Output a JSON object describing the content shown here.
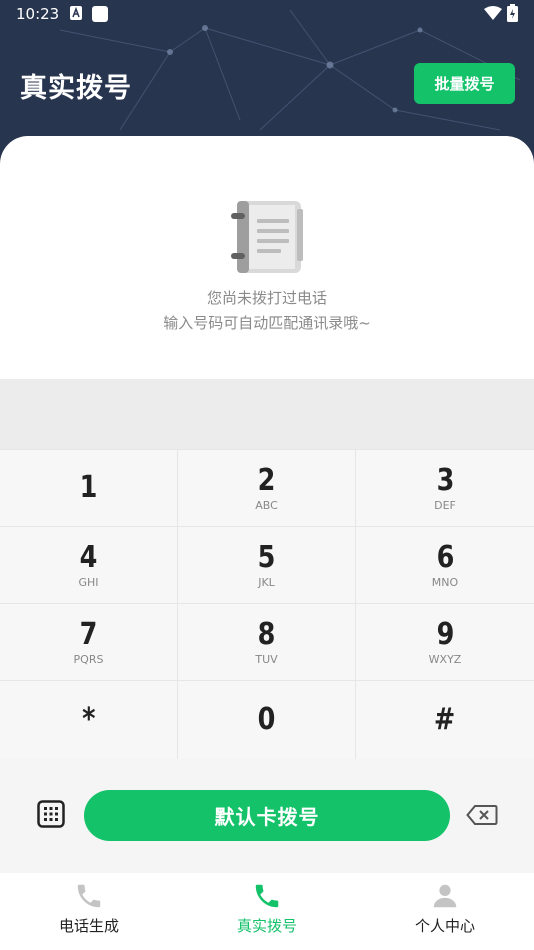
{
  "status_bar": {
    "time": "10:23"
  },
  "header": {
    "title": "真实拨号",
    "bulk_button": "批量拨号"
  },
  "empty_state": {
    "line1": "您尚未拨打过电话",
    "line2": "输入号码可自动匹配通讯录哦~"
  },
  "keypad": {
    "keys": [
      {
        "digit": "1",
        "letters": ""
      },
      {
        "digit": "2",
        "letters": "ABC"
      },
      {
        "digit": "3",
        "letters": "DEF"
      },
      {
        "digit": "4",
        "letters": "GHI"
      },
      {
        "digit": "5",
        "letters": "JKL"
      },
      {
        "digit": "6",
        "letters": "MNO"
      },
      {
        "digit": "7",
        "letters": "PQRS"
      },
      {
        "digit": "8",
        "letters": "TUV"
      },
      {
        "digit": "9",
        "letters": "WXYZ"
      },
      {
        "digit": "*",
        "letters": ""
      },
      {
        "digit": "0",
        "letters": ""
      },
      {
        "digit": "#",
        "letters": ""
      }
    ]
  },
  "actions": {
    "call_button": "默认卡拨号"
  },
  "nav": {
    "items": [
      {
        "label": "电话生成",
        "icon": "phone-icon"
      },
      {
        "label": "真实拨号",
        "icon": "phone-icon",
        "active": true
      },
      {
        "label": "个人中心",
        "icon": "person-icon"
      }
    ]
  },
  "colors": {
    "accent": "#14c26a",
    "header_bg": "#28354f"
  }
}
